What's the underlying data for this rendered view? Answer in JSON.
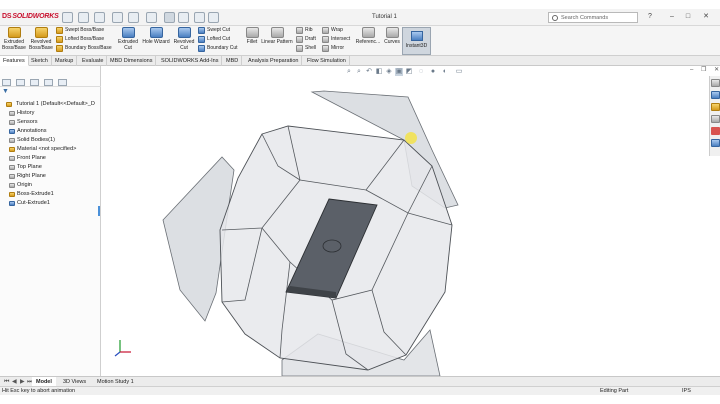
{
  "app": {
    "brand": "SOLIDWORKS",
    "brand_prefix": "DS",
    "document_title": "Tutorial 1",
    "search_placeholder": "Search Commands"
  },
  "command_manager": {
    "extruded_boss": "Extruded Boss/Base",
    "revolved_boss": "Revolved Boss/Base",
    "swept_boss": "Swept Boss/Base",
    "lofted_boss": "Lofted Boss/Base",
    "boundary_boss": "Boundary Boss/Base",
    "extruded_cut": "Extruded Cut",
    "hole_wizard": "Hole Wizard",
    "revolved_cut": "Revolved Cut",
    "swept_cut": "Swept Cut",
    "lofted_cut": "Lofted Cut",
    "boundary_cut": "Boundary Cut",
    "fillet": "Fillet",
    "linear_pattern": "Linear Pattern",
    "rib": "Rib",
    "draft": "Draft",
    "shell": "Shell",
    "wrap": "Wrap",
    "intersect": "Intersect",
    "mirror": "Mirror",
    "reference": "Referenc...",
    "curves": "Curves",
    "instant3d": "Instant3D"
  },
  "tabs": [
    "Features",
    "Sketch",
    "Markup",
    "Evaluate",
    "MBD Dimensions",
    "SOLIDWORKS Add-Ins",
    "MBD",
    "Analysis Preparation",
    "Flow Simulation"
  ],
  "tree": {
    "root": "Tutorial 1  (Default<<Default>_D",
    "items": [
      "History",
      "Sensors",
      "Annotations",
      "Solid Bodies(1)",
      "Material <not specified>",
      "Front Plane",
      "Top Plane",
      "Right Plane",
      "Origin",
      "Boss-Extrude1",
      "Cut-Extrude1"
    ]
  },
  "bottom_tabs": [
    "Model",
    "3D Views",
    "Motion Study 1"
  ],
  "status": {
    "message": "Hit Esc key to abort animation",
    "mode": "Editing Part",
    "units": "IPS"
  },
  "colors": {
    "brand_red": "#c8102e",
    "active_tab": "#ffffff",
    "model_face": "#d9dde2",
    "slot_fill": "#5b6068"
  }
}
